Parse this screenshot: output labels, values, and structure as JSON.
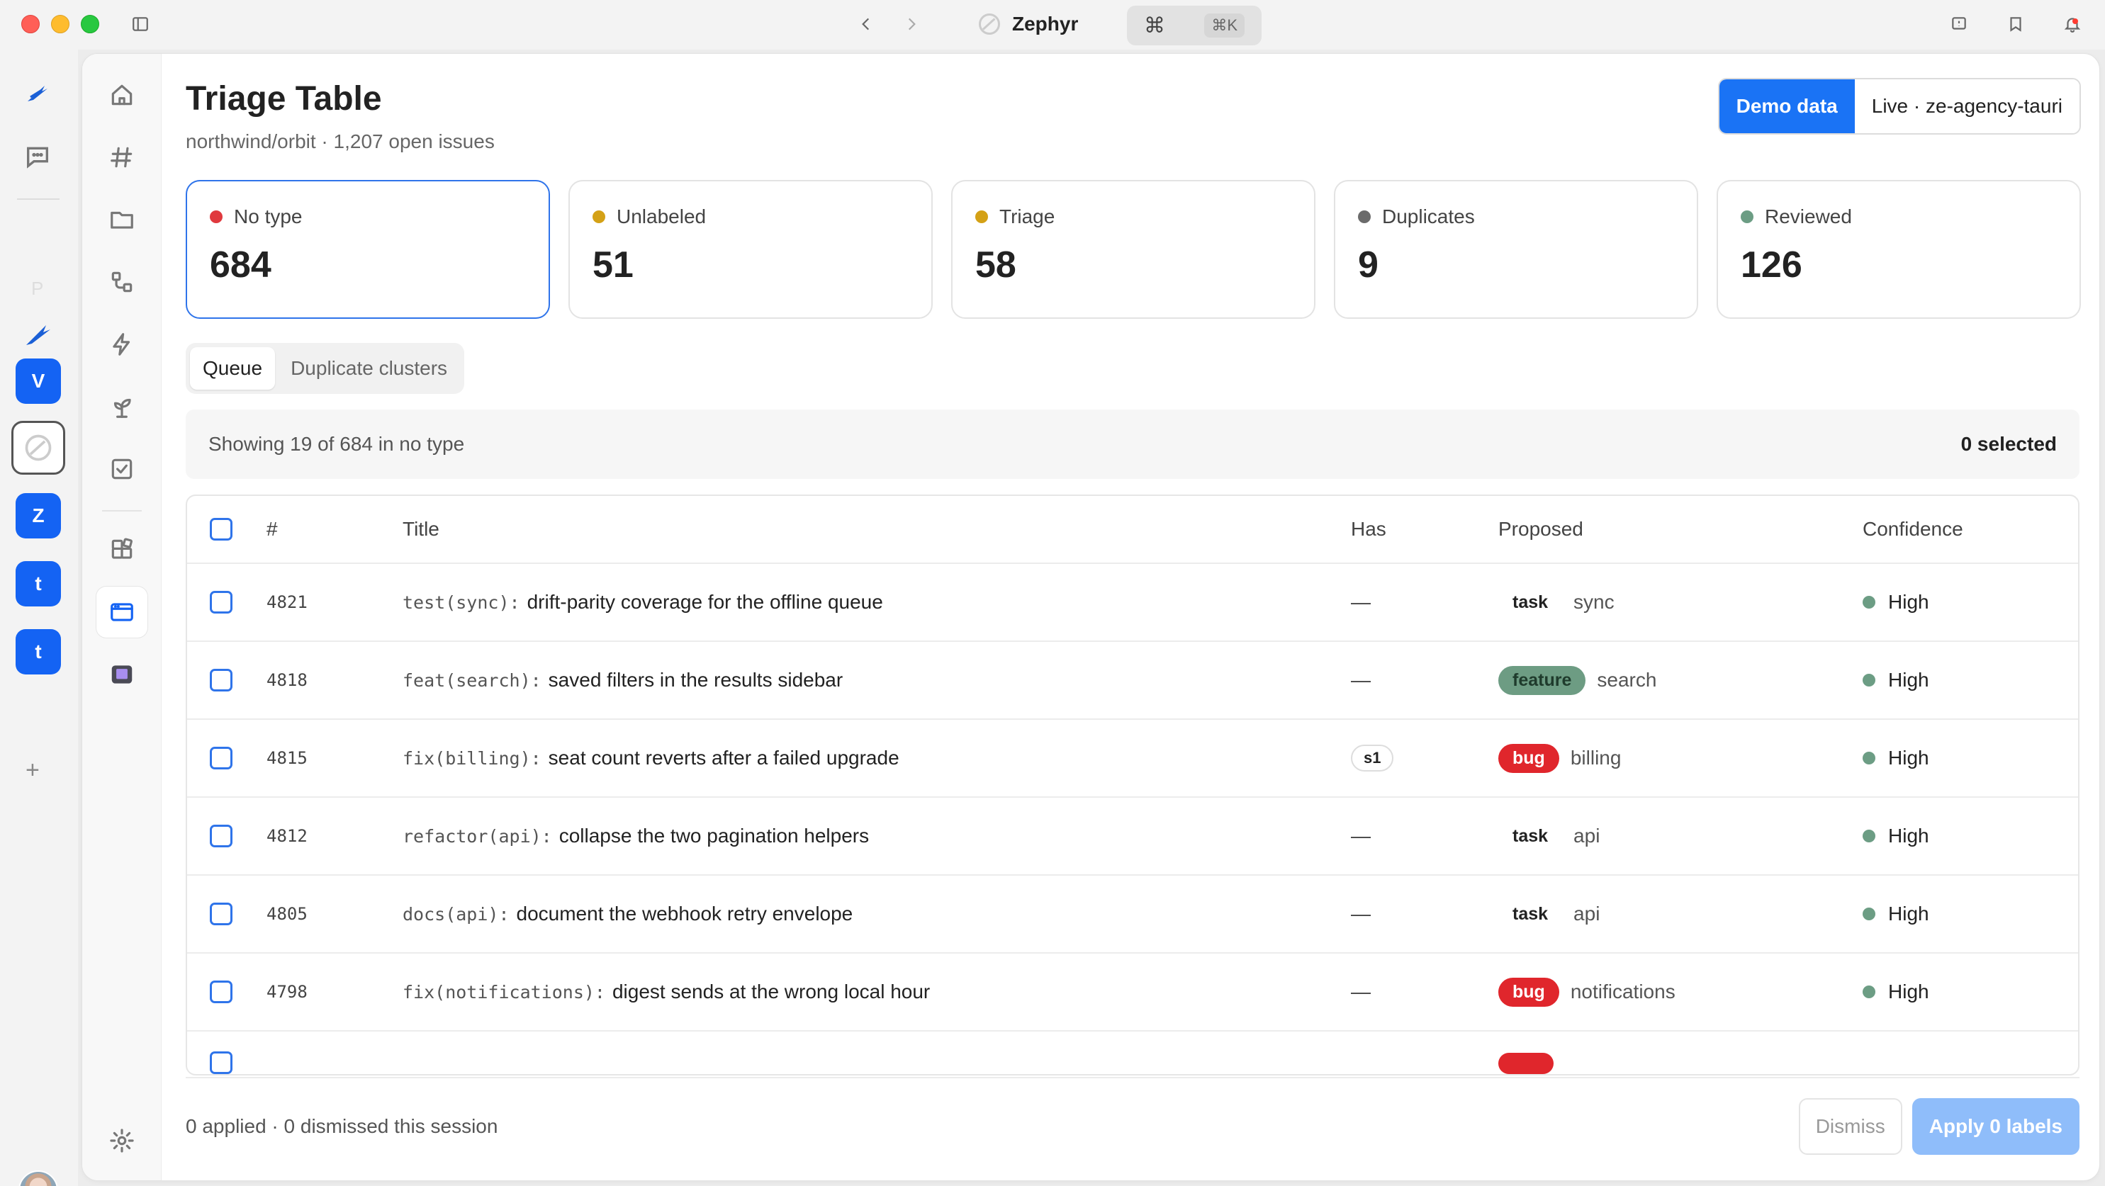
{
  "window": {
    "app_name": "Zephyr",
    "shortcut": "⌘K",
    "cmd_symbol": "⌘"
  },
  "rail": {
    "workspaces": [
      "V",
      "Z",
      "t",
      "t"
    ],
    "faded_letter": "P"
  },
  "header": {
    "title": "Triage Table",
    "subtitle": "northwind/orbit · 1,207 open issues",
    "source_options": [
      "Demo data",
      "Live · ze-agency-tauri"
    ],
    "selected_source": "Demo data"
  },
  "stats": [
    {
      "label": "No type",
      "value": "684",
      "color": "#e0393e",
      "selected": true
    },
    {
      "label": "Unlabeled",
      "value": "51",
      "color": "#d4a116"
    },
    {
      "label": "Triage",
      "value": "58",
      "color": "#d4a116"
    },
    {
      "label": "Duplicates",
      "value": "9",
      "color": "#6b6b6b"
    },
    {
      "label": "Reviewed",
      "value": "126",
      "color": "#6c9d84"
    }
  ],
  "tabs": [
    {
      "label": "Queue",
      "active": true
    },
    {
      "label": "Duplicate clusters"
    }
  ],
  "info": {
    "showing": "Showing 19 of 684 in no type",
    "selected": "0 selected"
  },
  "table": {
    "columns": [
      "#",
      "Title",
      "Has",
      "Proposed",
      "Confidence"
    ],
    "rows": [
      {
        "num": "4821",
        "scope": "test(sync):",
        "title": "drift-parity coverage for the offline queue",
        "has": "—",
        "tag": "task",
        "area": "sync",
        "confidence": "High"
      },
      {
        "num": "4818",
        "scope": "feat(search):",
        "title": "saved filters in the results sidebar",
        "has": "—",
        "tag": "feature",
        "area": "search",
        "confidence": "High"
      },
      {
        "num": "4815",
        "scope": "fix(billing):",
        "title": "seat count reverts after a failed upgrade",
        "has": "s1",
        "tag": "bug",
        "area": "billing",
        "confidence": "High"
      },
      {
        "num": "4812",
        "scope": "refactor(api):",
        "title": "collapse the two pagination helpers",
        "has": "—",
        "tag": "task",
        "area": "api",
        "confidence": "High"
      },
      {
        "num": "4805",
        "scope": "docs(api):",
        "title": "document the webhook retry envelope",
        "has": "—",
        "tag": "task",
        "area": "api",
        "confidence": "High"
      },
      {
        "num": "4798",
        "scope": "fix(notifications):",
        "title": "digest sends at the wrong local hour",
        "has": "—",
        "tag": "bug",
        "area": "notifications",
        "confidence": "High"
      }
    ]
  },
  "footer": {
    "status": "0 applied · 0 dismissed this session",
    "dismiss_label": "Dismiss",
    "apply_label": "Apply 0 labels"
  }
}
